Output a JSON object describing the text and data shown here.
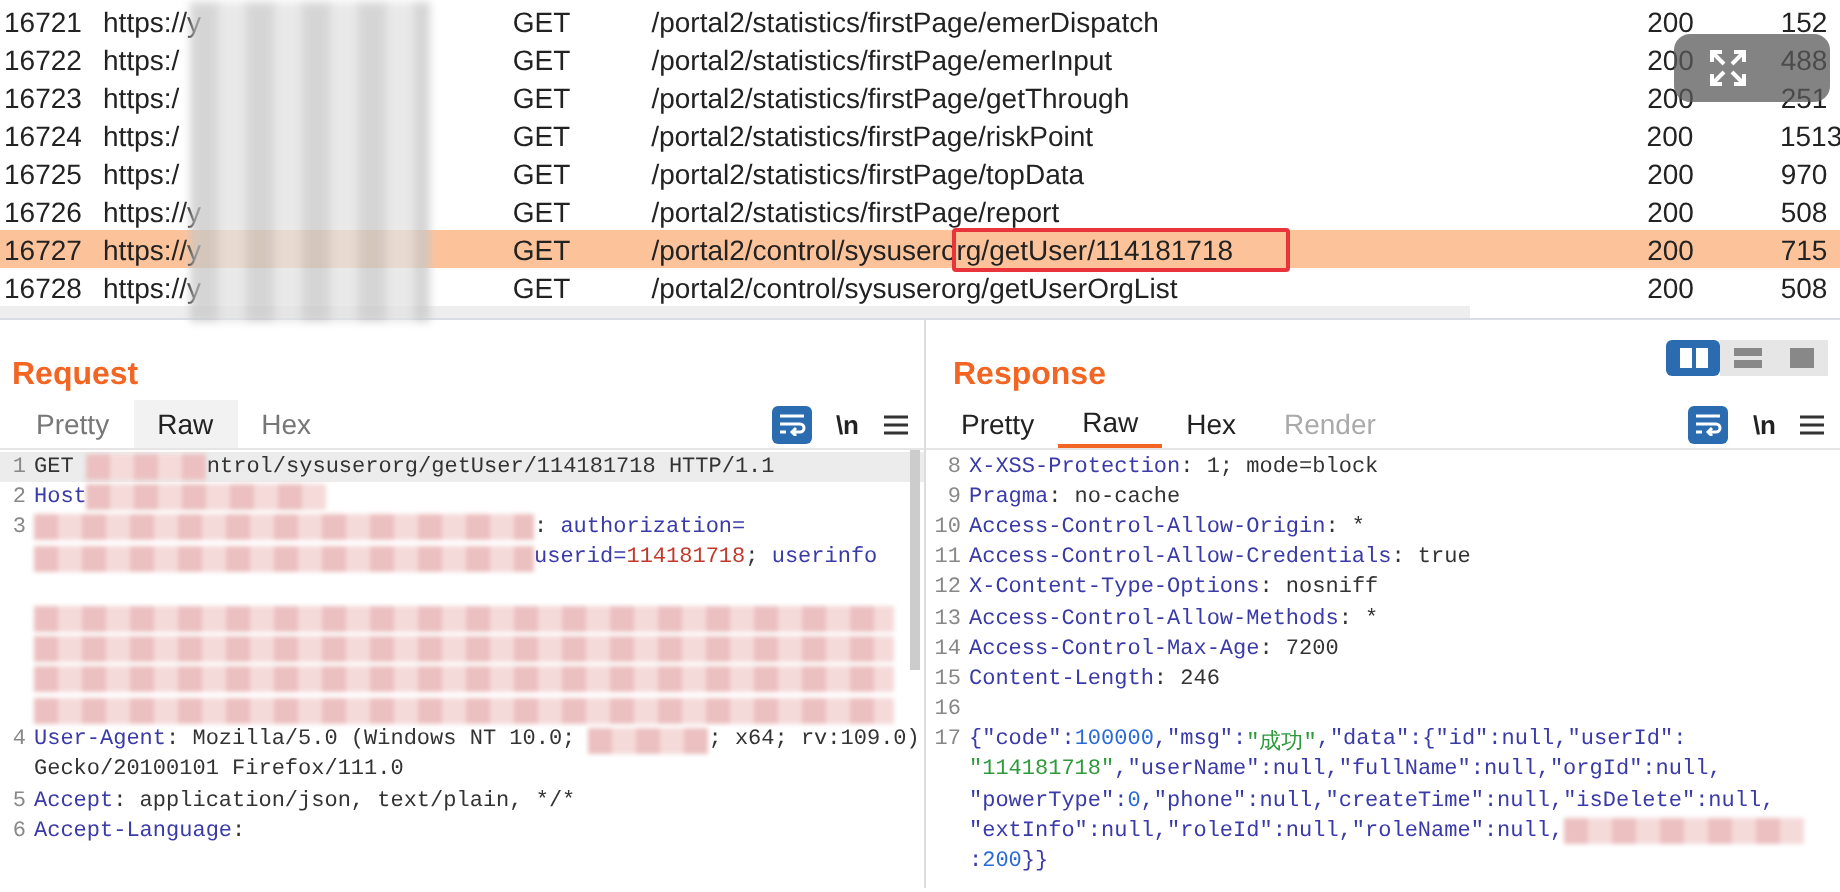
{
  "history": {
    "rows": [
      {
        "number": "16721",
        "host": "https://y",
        "method": "GET",
        "path": "/portal2/statistics/firstPage/emerDispatch",
        "status": "200",
        "length": "152",
        "selected": false,
        "marked": false
      },
      {
        "number": "16722",
        "host": "https:/",
        "method": "GET",
        "path": "/portal2/statistics/firstPage/emerInput",
        "status": "200",
        "length": "488",
        "selected": false,
        "marked": false
      },
      {
        "number": "16723",
        "host": "https:/",
        "method": "GET",
        "path": "/portal2/statistics/firstPage/getThrough",
        "status": "200",
        "length": "251",
        "selected": false,
        "marked": false
      },
      {
        "number": "16724",
        "host": "https:/",
        "method": "GET",
        "path": "/portal2/statistics/firstPage/riskPoint",
        "status": "200",
        "length": "1513",
        "selected": false,
        "marked": false
      },
      {
        "number": "16725",
        "host": "https:/",
        "method": "GET",
        "path": "/portal2/statistics/firstPage/topData",
        "status": "200",
        "length": "970",
        "selected": false,
        "marked": false
      },
      {
        "number": "16726",
        "host": "https://y",
        "method": "GET",
        "path": "/portal2/statistics/firstPage/report",
        "status": "200",
        "length": "508",
        "selected": false,
        "marked": false
      },
      {
        "number": "16727",
        "host": "https://y",
        "method": "GET",
        "path": "/portal2/control/sysuserorg/getUser/114181718",
        "status": "200",
        "length": "715",
        "selected": true,
        "marked": true
      },
      {
        "number": "16728",
        "host": "https://y",
        "method": "GET",
        "path": "/portal2/control/sysuserorg/getUserOrgList",
        "status": "200",
        "length": "508",
        "selected": false,
        "marked": false
      }
    ]
  },
  "panes": [
    {
      "title": "Request",
      "tabs": [
        {
          "label": "Pretty",
          "selected": false,
          "disabled": false
        },
        {
          "label": "Raw",
          "selected": true,
          "disabled": false
        },
        {
          "label": "Hex",
          "selected": false,
          "disabled": false
        }
      ],
      "newline_toggle": "\\n",
      "lines": [
        {
          "number": "1",
          "highlighted": true,
          "segments": [
            {
              "kind": "plain",
              "text": "GET "
            },
            {
              "kind": "redacted"
            },
            {
              "kind": "plain",
              "text": "ntrol/sysuserorg/getUser/114181718 HTTP/1.1"
            }
          ]
        },
        {
          "number": "2",
          "highlighted": false,
          "segments": [
            {
              "kind": "name",
              "text": "Host"
            },
            {
              "kind": "redacted"
            }
          ]
        },
        {
          "number": "3",
          "highlighted": false,
          "segments": [
            {
              "kind": "redacted"
            },
            {
              "kind": "plain",
              "text": ": "
            },
            {
              "kind": "name",
              "text": "authorization="
            }
          ]
        },
        {
          "highlighted": false,
          "segments": [
            {
              "kind": "redacted"
            },
            {
              "kind": "name",
              "text": "userid="
            },
            {
              "kind": "value",
              "text": "114181718"
            },
            {
              "kind": "plain",
              "text": "; "
            },
            {
              "kind": "name",
              "text": "userinfo"
            }
          ]
        },
        {
          "highlighted": false
        },
        {
          "highlighted": false,
          "segments": [
            {
              "kind": "redacted"
            }
          ]
        },
        {
          "highlighted": false,
          "segments": [
            {
              "kind": "redacted"
            }
          ]
        },
        {
          "highlighted": false,
          "segments": [
            {
              "kind": "redacted"
            }
          ]
        },
        {
          "highlighted": false,
          "segments": [
            {
              "kind": "redacted"
            }
          ]
        },
        {
          "number": "4",
          "highlighted": false,
          "segments": [
            {
              "kind": "name",
              "text": "User-Agent"
            },
            {
              "kind": "plain",
              "text": ": Mozilla/5.0 (Windows NT 10.0; "
            },
            {
              "kind": "redacted"
            },
            {
              "kind": "plain",
              "text": "; x64; rv:109.0)"
            }
          ]
        },
        {
          "highlighted": false,
          "segments": [
            {
              "kind": "plain",
              "text": "Gecko/20100101 Firefox/111.0"
            }
          ]
        },
        {
          "number": "5",
          "highlighted": false,
          "segments": [
            {
              "kind": "name",
              "text": "Accept"
            },
            {
              "kind": "plain",
              "text": ": application/json, text/plain, */*"
            }
          ]
        },
        {
          "number": "6",
          "highlighted": false,
          "segments": [
            {
              "kind": "name",
              "text": "Accept-Language"
            },
            {
              "kind": "plain",
              "text": ":"
            }
          ]
        }
      ]
    },
    {
      "title": "Response",
      "tabs": [
        {
          "label": "Pretty",
          "selected": false,
          "disabled": false
        },
        {
          "label": "Raw",
          "selected": true,
          "disabled": false
        },
        {
          "label": "Hex",
          "selected": false,
          "disabled": false
        },
        {
          "label": "Render",
          "selected": false,
          "disabled": true
        }
      ],
      "newline_toggle": "\\n",
      "lines": [
        {
          "number": "8",
          "highlighted": false,
          "segments": [
            {
              "kind": "name",
              "text": "X-XSS-Protection"
            },
            {
              "kind": "plain",
              "text": ": 1; mode=block"
            }
          ]
        },
        {
          "number": "9",
          "highlighted": false,
          "segments": [
            {
              "kind": "name",
              "text": "Pragma"
            },
            {
              "kind": "plain",
              "text": ": no-cache"
            }
          ]
        },
        {
          "number": "10",
          "highlighted": false,
          "segments": [
            {
              "kind": "name",
              "text": "Access-Control-Allow-Origin"
            },
            {
              "kind": "plain",
              "text": ": *"
            }
          ]
        },
        {
          "number": "11",
          "highlighted": false,
          "segments": [
            {
              "kind": "name",
              "text": "Access-Control-Allow-Credentials"
            },
            {
              "kind": "plain",
              "text": ": true"
            }
          ]
        },
        {
          "number": "12",
          "highlighted": false,
          "segments": [
            {
              "kind": "name",
              "text": "X-Content-Type-Options"
            },
            {
              "kind": "plain",
              "text": ": nosniff"
            }
          ]
        },
        {
          "number": "13",
          "highlighted": false,
          "segments": [
            {
              "kind": "name",
              "text": "Access-Control-Allow-Methods"
            },
            {
              "kind": "plain",
              "text": ": *"
            }
          ]
        },
        {
          "number": "14",
          "highlighted": false,
          "segments": [
            {
              "kind": "name",
              "text": "Access-Control-Max-Age"
            },
            {
              "kind": "plain",
              "text": ": 7200"
            }
          ]
        },
        {
          "number": "15",
          "highlighted": false,
          "segments": [
            {
              "kind": "name",
              "text": "Content-Length"
            },
            {
              "kind": "plain",
              "text": ": 246"
            }
          ]
        },
        {
          "number": "16",
          "highlighted": false
        },
        {
          "number": "17",
          "highlighted": false,
          "segments": [
            {
              "kind": "key",
              "text": "{\"code\":"
            },
            {
              "kind": "number",
              "text": "100000"
            },
            {
              "kind": "key",
              "text": ",\"msg\":"
            },
            {
              "kind": "string",
              "text": "\"成功\""
            },
            {
              "kind": "key",
              "text": ",\"data\":{\"id\":null,\"userId\":"
            }
          ]
        },
        {
          "highlighted": false,
          "segments": [
            {
              "kind": "string",
              "text": "\"114181718\""
            },
            {
              "kind": "key",
              "text": ",\"userName\":null,\"fullName\":null,\"orgId\":null,"
            }
          ]
        },
        {
          "highlighted": false,
          "segments": [
            {
              "kind": "key",
              "text": "\"powerType\":"
            },
            {
              "kind": "number",
              "text": "0"
            },
            {
              "kind": "key",
              "text": ",\"phone\":null,\"createTime\":null,\"isDelete\":null,"
            }
          ]
        },
        {
          "highlighted": false,
          "segments": [
            {
              "kind": "key",
              "text": "\"extInfo\":null,\"roleId\":null,\"roleName\":null,"
            },
            {
              "kind": "redacted"
            }
          ]
        },
        {
          "highlighted": false,
          "segments": [
            {
              "kind": "key",
              "text": ":"
            },
            {
              "kind": "number",
              "text": "200"
            },
            {
              "kind": "key",
              "text": "}}"
            }
          ]
        }
      ]
    }
  ],
  "layout_toggle": [
    {
      "selected": true
    },
    {
      "selected": false
    },
    {
      "selected": false
    }
  ]
}
